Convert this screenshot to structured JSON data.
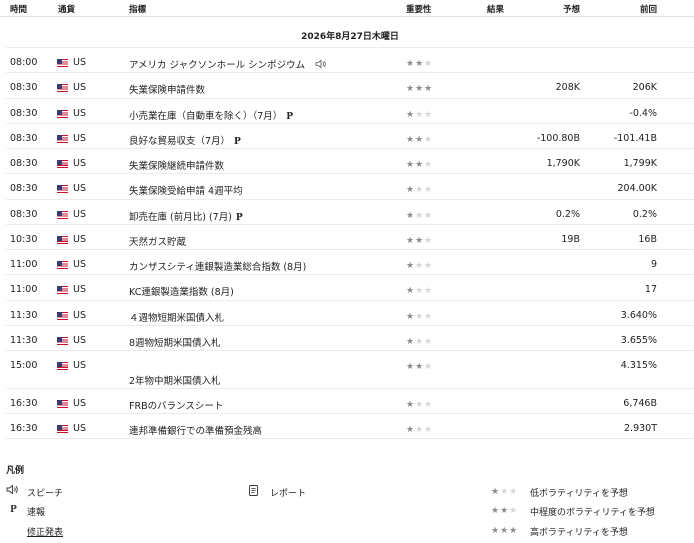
{
  "header": {
    "time": "時間",
    "currency": "通貨",
    "indicator": "指標",
    "importance": "重要性",
    "actual": "結果",
    "forecast": "予想",
    "previous": "前回"
  },
  "date_label": "2026年8月27日木曜日",
  "events": [
    {
      "time": "08:00",
      "currency": "US",
      "name": "アメリカ ジャクソンホール シンポジウム",
      "stars": 2,
      "tag": "speech",
      "forecast": "",
      "previous": ""
    },
    {
      "time": "08:30",
      "currency": "US",
      "name": "失業保険申請件数",
      "stars": 3,
      "tag": "",
      "forecast": "208K",
      "previous": "206K"
    },
    {
      "time": "08:30",
      "currency": "US",
      "name": "小売業在庫（自動車を除く）（7月）",
      "stars": 1,
      "tag": "P",
      "forecast": "",
      "previous": "-0.4%"
    },
    {
      "time": "08:30",
      "currency": "US",
      "name": "良好な貿易収支（7月）",
      "stars": 2,
      "tag": "P",
      "forecast": "-100.80B",
      "previous": "-101.41B"
    },
    {
      "time": "08:30",
      "currency": "US",
      "name": "失業保険継続申請件数",
      "stars": 2,
      "tag": "",
      "forecast": "1,790K",
      "previous": "1,799K"
    },
    {
      "time": "08:30",
      "currency": "US",
      "name": "失業保険受給申請 4週平均",
      "stars": 1,
      "tag": "",
      "forecast": "",
      "previous": "204.00K"
    },
    {
      "time": "08:30",
      "currency": "US",
      "name": "卸売在庫 (前月比) (7月)",
      "stars": 1,
      "tag": "P",
      "forecast": "0.2%",
      "previous": "0.2%"
    },
    {
      "time": "10:30",
      "currency": "US",
      "name": "天然ガス貯蔵",
      "stars": 2,
      "tag": "",
      "forecast": "19B",
      "previous": "16B"
    },
    {
      "time": "11:00",
      "currency": "US",
      "name": "カンザスシティ連銀製造業総合指数 (8月)",
      "stars": 1,
      "tag": "",
      "forecast": "",
      "previous": "9"
    },
    {
      "time": "11:00",
      "currency": "US",
      "name": "KC連銀製造業指数 (8月)",
      "stars": 1,
      "tag": "",
      "forecast": "",
      "previous": "17"
    },
    {
      "time": "11:30",
      "currency": "US",
      "name": "４週物短期米国債入札",
      "stars": 1,
      "tag": "",
      "forecast": "",
      "previous": "3.640%"
    },
    {
      "time": "11:30",
      "currency": "US",
      "name": "8週物短期米国債入札",
      "stars": 1,
      "tag": "",
      "forecast": "",
      "previous": "3.655%"
    },
    {
      "time": "15:00",
      "currency": "US",
      "name": "2年物中期米国債入札",
      "stars": 2,
      "tag": "",
      "forecast": "",
      "previous": "4.315%"
    },
    {
      "time": "16:30",
      "currency": "US",
      "name": "FRBのバランスシート",
      "stars": 1,
      "tag": "",
      "forecast": "",
      "previous": "6,746B"
    },
    {
      "time": "16:30",
      "currency": "US",
      "name": "連邦準備銀行での準備預金残高",
      "stars": 1,
      "tag": "",
      "forecast": "",
      "previous": "2.930T"
    }
  ],
  "legend": {
    "title": "凡例",
    "speech": "スピーチ",
    "preliminary_symbol": "P",
    "preliminary": "速報",
    "revised": "修正発表",
    "report": "レポート",
    "low": "低ボラティリティを予想",
    "medium": "中程度のボラティリティを予想",
    "high": "高ボラティリティを予想"
  },
  "colors": {
    "star_on": "#8c8c8c",
    "star_off": "#d6d6d6",
    "flag_red": "#c8102e",
    "flag_blue": "#3c3b6e"
  }
}
